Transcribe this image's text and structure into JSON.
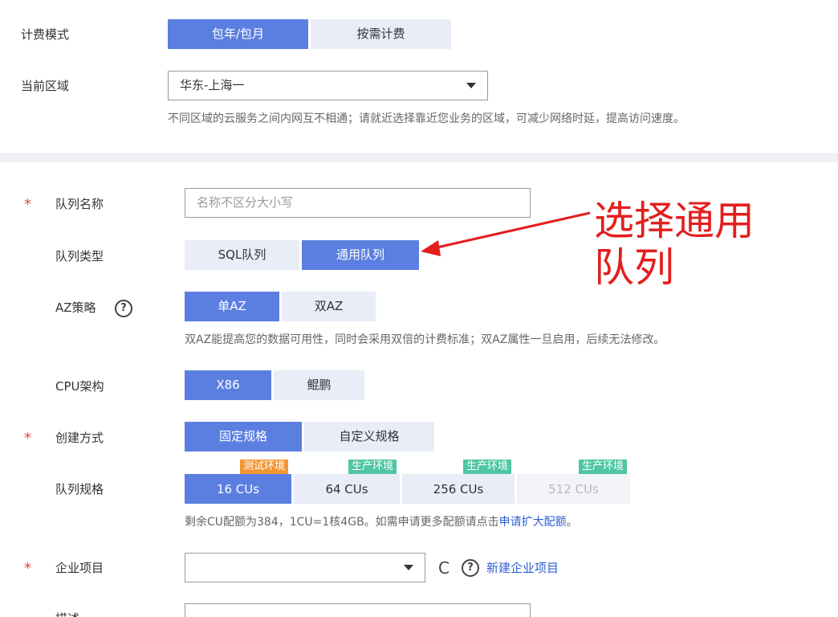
{
  "billing": {
    "label": "计费模式",
    "options": [
      "包年/包月",
      "按需计费"
    ]
  },
  "region": {
    "label": "当前区域",
    "value": "华东-上海一",
    "hint": "不同区域的云服务之间内网互不相通；请就近选择靠近您业务的区域，可减少网络时延，提高访问速度。"
  },
  "queue_name": {
    "required": "*",
    "label": "队列名称",
    "placeholder": "名称不区分大小写"
  },
  "queue_type": {
    "label": "队列类型",
    "options": [
      "SQL队列",
      "通用队列"
    ]
  },
  "az": {
    "label": "AZ策略",
    "help_glyph": "?",
    "options": [
      "单AZ",
      "双AZ"
    ],
    "hint": "双AZ能提高您的数据可用性，同时会采用双倍的计费标准；双AZ属性一旦启用，后续无法修改。"
  },
  "cpu": {
    "label": "CPU架构",
    "options": [
      "X86",
      "鲲鹏"
    ]
  },
  "create_mode": {
    "required": "*",
    "label": "创建方式",
    "options": [
      "固定规格",
      "自定义规格"
    ]
  },
  "spec": {
    "label": "队列规格",
    "options": [
      {
        "value": "16 CUs",
        "badge": "测试环境"
      },
      {
        "value": "64 CUs",
        "badge": "生产环境"
      },
      {
        "value": "256 CUs",
        "badge": "生产环境"
      },
      {
        "value": "512 CUs",
        "badge": "生产环境"
      }
    ],
    "hint_prefix": "剩余CU配额为384，1CU=1核4GB。如需申请更多配额请点击",
    "hint_link": "申请扩大配额",
    "hint_suffix": "。"
  },
  "enterprise": {
    "required": "*",
    "label": "企业项目",
    "value": "",
    "refresh_glyph": "C",
    "help_glyph": "?",
    "new_link": "新建企业项目"
  },
  "description": {
    "label": "描述"
  },
  "annotation": {
    "line1": "选择通用",
    "line2": "队列"
  },
  "colors": {
    "active": "#5b7fe1",
    "inactive": "#e8edf8",
    "badge_test": "#f39632",
    "badge_prod": "#4fc6a3",
    "annotation": "#e31e1e",
    "link": "#2f5fd0"
  }
}
